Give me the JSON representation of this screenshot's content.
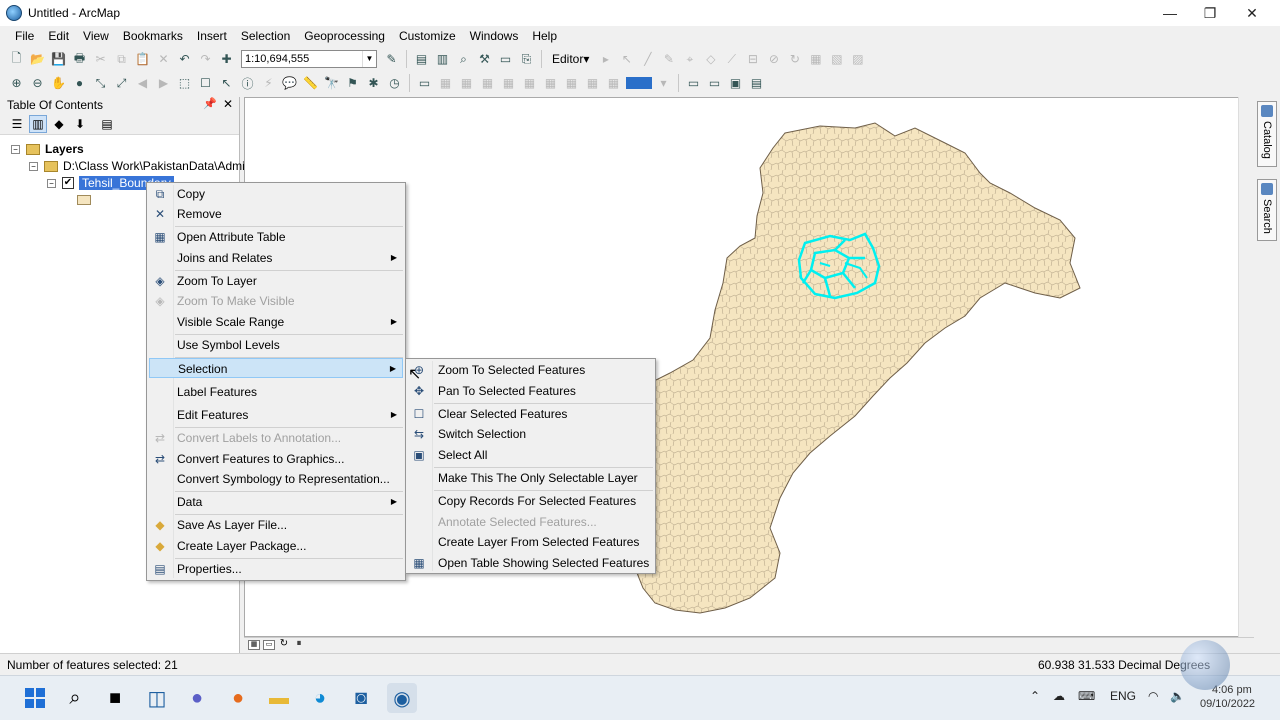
{
  "window": {
    "title": "Untitled - ArcMap",
    "minimize": "—",
    "restore": "❐",
    "close": "✕"
  },
  "menubar": [
    "File",
    "Edit",
    "View",
    "Bookmarks",
    "Insert",
    "Selection",
    "Geoprocessing",
    "Customize",
    "Windows",
    "Help"
  ],
  "toolbar": {
    "scale": "1:10,694,555",
    "editor_label": "Editor▾"
  },
  "toc": {
    "title": "Table Of Contents",
    "pin": "📌",
    "close": "✕",
    "root_label": "Layers",
    "path_label": "D:\\Class Work\\PakistanData\\Admin",
    "layer_label": "Tehsil_Boundary"
  },
  "layer_context_menu": [
    {
      "label": "Copy",
      "icon": "copy-icon",
      "glyph": "⧉",
      "enabled": true
    },
    {
      "label": "Remove",
      "icon": "remove-icon",
      "glyph": "✕",
      "enabled": true
    },
    {
      "label": "Open Attribute Table",
      "icon": "attribute-table-icon",
      "glyph": "▦",
      "enabled": true
    },
    {
      "label": "Joins and Relates",
      "icon": "",
      "glyph": "",
      "enabled": true,
      "submenu": true
    },
    {
      "label": "Zoom To Layer",
      "icon": "zoom-to-layer-icon",
      "glyph": "◈",
      "enabled": true
    },
    {
      "label": "Zoom To Make Visible",
      "icon": "zoom-visible-icon",
      "glyph": "◈",
      "enabled": false
    },
    {
      "label": "Visible Scale Range",
      "icon": "",
      "glyph": "",
      "enabled": true,
      "submenu": true
    },
    {
      "label": "Use Symbol Levels",
      "icon": "",
      "glyph": "",
      "enabled": true
    },
    {
      "label": "Selection",
      "icon": "",
      "glyph": "",
      "enabled": true,
      "submenu": true,
      "highlighted": true
    },
    {
      "label": "Label Features",
      "icon": "",
      "glyph": "",
      "enabled": true
    },
    {
      "label": "Edit Features",
      "icon": "",
      "glyph": "",
      "enabled": true,
      "submenu": true
    },
    {
      "label": "Convert Labels to Annotation...",
      "icon": "convert-labels-icon",
      "glyph": "⇄",
      "enabled": false
    },
    {
      "label": "Convert Features to Graphics...",
      "icon": "convert-features-icon",
      "glyph": "⇄",
      "enabled": true
    },
    {
      "label": "Convert Symbology to Representation...",
      "icon": "",
      "glyph": "",
      "enabled": true
    },
    {
      "label": "Data",
      "icon": "",
      "glyph": "",
      "enabled": true,
      "submenu": true
    },
    {
      "label": "Save As Layer File...",
      "icon": "layer-file-icon",
      "glyph": "◆",
      "enabled": true
    },
    {
      "label": "Create Layer Package...",
      "icon": "layer-package-icon",
      "glyph": "◆",
      "enabled": true
    },
    {
      "label": "Properties...",
      "icon": "properties-icon",
      "glyph": "▤",
      "enabled": true
    }
  ],
  "selection_submenu": [
    {
      "label": "Zoom To Selected Features",
      "icon": "zoom-selected-icon",
      "glyph": "⊕",
      "enabled": true
    },
    {
      "label": "Pan To Selected Features",
      "icon": "pan-selected-icon",
      "glyph": "✥",
      "enabled": true
    },
    {
      "label": "Clear Selected Features",
      "icon": "clear-selection-icon",
      "glyph": "☐",
      "enabled": true
    },
    {
      "label": "Switch Selection",
      "icon": "switch-selection-icon",
      "glyph": "⇆",
      "enabled": true
    },
    {
      "label": "Select All",
      "icon": "select-all-icon",
      "glyph": "▣",
      "enabled": true
    },
    {
      "label": "Make This The Only Selectable Layer",
      "icon": "",
      "glyph": "",
      "enabled": true
    },
    {
      "label": "Copy Records For Selected Features",
      "icon": "",
      "glyph": "",
      "enabled": true
    },
    {
      "label": "Annotate Selected Features...",
      "icon": "",
      "glyph": "",
      "enabled": false
    },
    {
      "label": "Create Layer From Selected Features",
      "icon": "",
      "glyph": "",
      "enabled": true
    },
    {
      "label": "Open Table Showing Selected Features",
      "icon": "open-table-icon",
      "glyph": "▦",
      "enabled": true
    }
  ],
  "side_tabs": [
    "Catalog",
    "Search"
  ],
  "status": {
    "selected": "Number of features selected: 21",
    "coords": "60.938  31.533 Decimal Degrees"
  },
  "taskbar": {
    "language": "ENG",
    "time": "4:06 pm",
    "date": "09/10/2022"
  },
  "colors": {
    "map_fill": "#f5e5c0",
    "selection": "#00ffff",
    "highlight": "#cce4f7"
  }
}
